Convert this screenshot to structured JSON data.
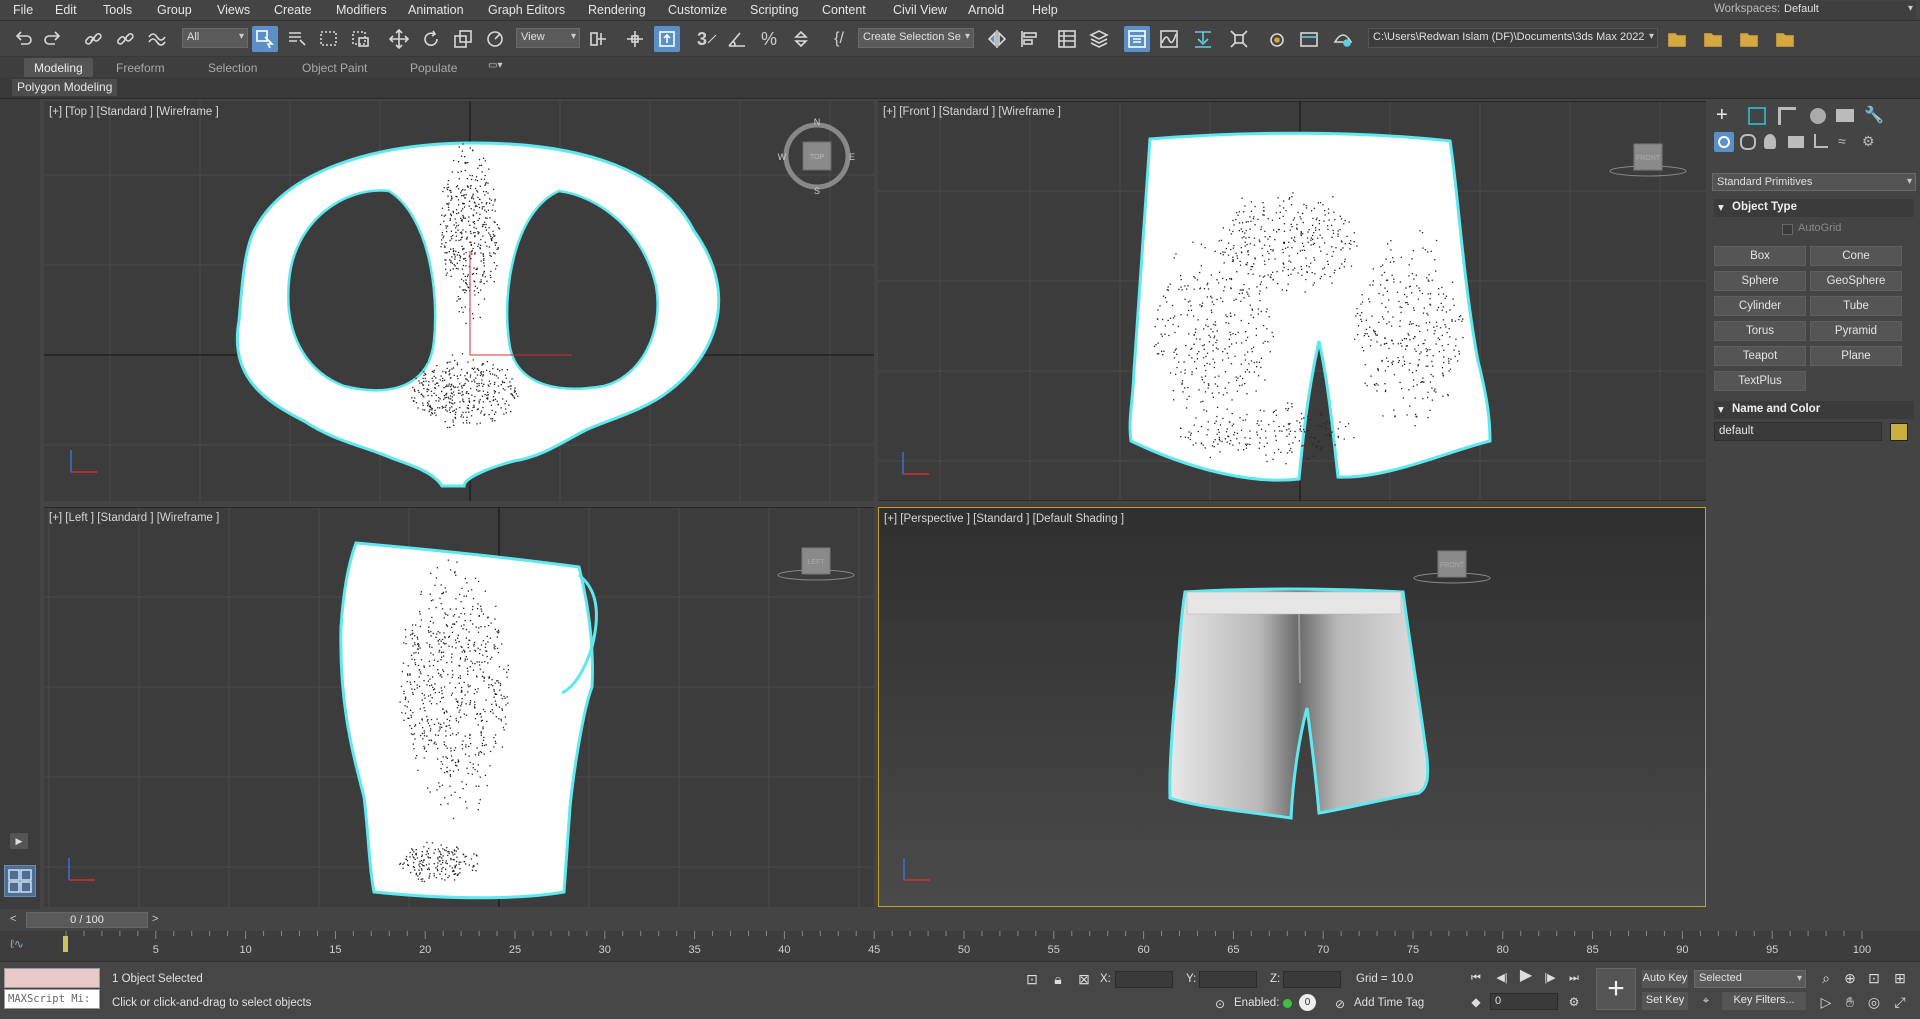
{
  "menu": [
    "File",
    "Edit",
    "Tools",
    "Group",
    "Views",
    "Create",
    "Modifiers",
    "Animation",
    "Graph Editors",
    "Rendering",
    "Customize",
    "Scripting",
    "Content",
    "Civil View",
    "Arnold",
    "Help"
  ],
  "workspaces": {
    "label": "Workspaces:",
    "value": "Default"
  },
  "toolbar": {
    "filter_value": "All",
    "view_value": "View",
    "selection_set": "Create Selection Se",
    "project_path": "C:\\Users\\Redwan Islam (DF)\\Documents\\3ds Max 2022",
    "snap_label": "3"
  },
  "ribbon": {
    "tabs": [
      "Modeling",
      "Freeform",
      "Selection",
      "Object Paint",
      "Populate"
    ],
    "sub_label": "Polygon Modeling"
  },
  "viewports": {
    "top": {
      "label": "[+] [Top ] [Standard ] [Wireframe ]",
      "cube": "TOP"
    },
    "front": {
      "label": "[+] [Front ] [Standard ] [Wireframe ]",
      "cube": "FRONT"
    },
    "left": {
      "label": "[+] [Left ] [Standard ] [Wireframe ]",
      "cube": "LEFT"
    },
    "perspective": {
      "label": "[+] [Perspective ] [Standard ] [Default Shading ]",
      "cube": "FRONT"
    }
  },
  "compass": {
    "n": "N",
    "s": "S",
    "e": "E",
    "w": "W"
  },
  "command_panel": {
    "category": "Standard Primitives",
    "object_type_title": "Object Type",
    "autogrid": "AutoGrid",
    "buttons": [
      "Box",
      "Cone",
      "Sphere",
      "GeoSphere",
      "Cylinder",
      "Tube",
      "Torus",
      "Pyramid",
      "Teapot",
      "Plane",
      "TextPlus"
    ],
    "name_color_title": "Name and Color",
    "object_name": "default",
    "object_color": "#c8b040"
  },
  "time": {
    "slider_label": "0 / 100",
    "ticks": [
      "5",
      "10",
      "15",
      "20",
      "25",
      "30",
      "35",
      "40",
      "45",
      "50",
      "55",
      "60",
      "65",
      "70",
      "75",
      "80",
      "85",
      "90",
      "95",
      "100"
    ]
  },
  "status": {
    "maxscript": "MAXScript Mi:",
    "selected": "1 Object Selected",
    "prompt": "Click or click-and-drag to select objects",
    "x_label": "X:",
    "y_label": "Y:",
    "z_label": "Z:",
    "grid": "Grid = 10.0",
    "enabled": "Enabled:",
    "add_time_tag": "Add Time Tag",
    "auto_key": "Auto Key",
    "set_key": "Set Key",
    "selected_dropdown": "Selected",
    "key_filters": "Key Filters...",
    "frame": "0",
    "enabled_count": "0"
  }
}
